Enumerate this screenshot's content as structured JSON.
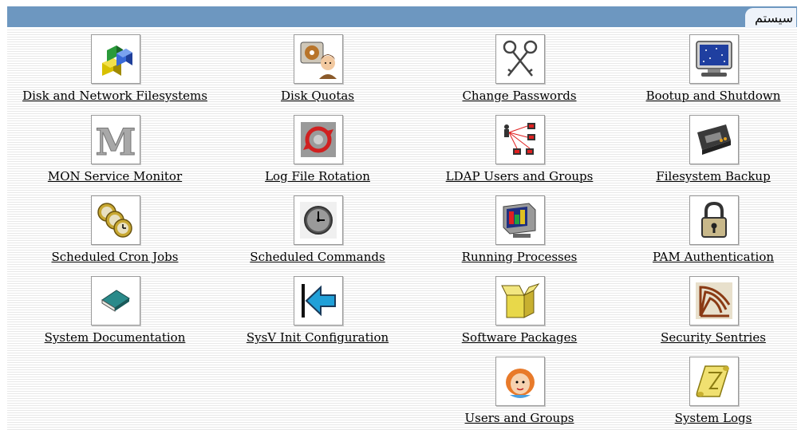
{
  "header": {
    "title": "سيستم"
  },
  "modules": [
    {
      "label": "Disk and Network Filesystems",
      "icon": "disk-filesystems-icon"
    },
    {
      "label": "Disk Quotas",
      "icon": "disk-quotas-icon"
    },
    {
      "label": "Change Passwords",
      "icon": "keys-icon"
    },
    {
      "label": "Bootup and Shutdown",
      "icon": "monitor-icon"
    },
    {
      "label": "MON Service Monitor",
      "icon": "mon-letter-icon"
    },
    {
      "label": "Log File Rotation",
      "icon": "log-rotation-icon"
    },
    {
      "label": "LDAP Users and Groups",
      "icon": "ldap-network-icon"
    },
    {
      "label": "Filesystem Backup",
      "icon": "tape-backup-icon"
    },
    {
      "label": "Scheduled Cron Jobs",
      "icon": "clocks-icon"
    },
    {
      "label": "Scheduled Commands",
      "icon": "clock-grey-icon"
    },
    {
      "label": "Running Processes",
      "icon": "processes-monitor-icon"
    },
    {
      "label": "PAM Authentication",
      "icon": "padlock-icon"
    },
    {
      "label": "System Documentation",
      "icon": "book-icon"
    },
    {
      "label": "SysV Init Configuration",
      "icon": "arrow-left-icon"
    },
    {
      "label": "Software Packages",
      "icon": "package-box-icon"
    },
    {
      "label": "Security Sentries",
      "icon": "sentry-icon"
    },
    {
      "label": "Users and Groups",
      "icon": "user-face-icon"
    },
    {
      "label": "System Logs",
      "icon": "scroll-icon"
    }
  ]
}
